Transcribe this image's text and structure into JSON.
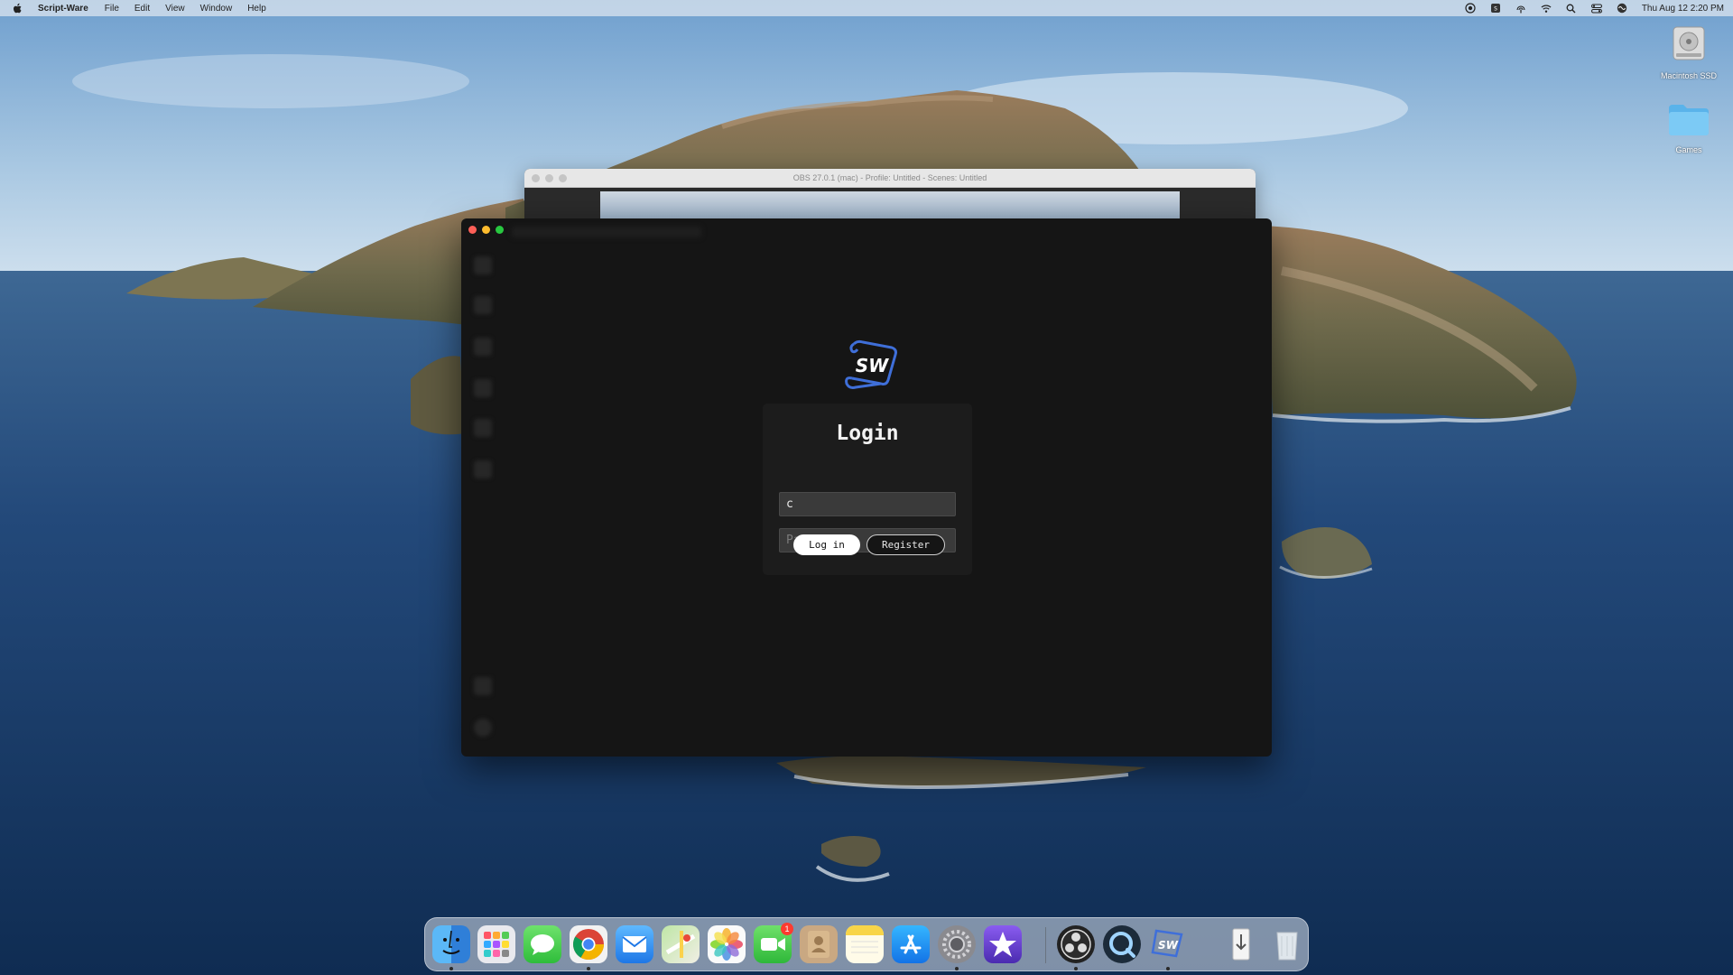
{
  "menubar": {
    "app_name": "Script-Ware",
    "menus": [
      "File",
      "Edit",
      "View",
      "Window",
      "Help"
    ],
    "clock": "Thu Aug 12  2:20 PM",
    "status_icons": [
      "screen-record-icon",
      "script-ware-menu-icon",
      "airdrop-icon",
      "wifi-icon",
      "spotlight-icon",
      "control-center-icon",
      "siri-icon"
    ]
  },
  "desktop": {
    "icons": [
      {
        "name": "Macintosh SSD",
        "icon": "hard-drive-icon"
      },
      {
        "name": "Games",
        "icon": "folder-icon"
      }
    ]
  },
  "obs_window": {
    "title": "OBS 27.0.1 (mac) - Profile: Untitled - Scenes: Untitled"
  },
  "login": {
    "title": "Login",
    "username_value": "c",
    "password_placeholder": "Password",
    "login_button": "Log in",
    "register_button": "Register",
    "logo_text": "SW"
  },
  "dock": {
    "items": [
      "finder-icon",
      "launchpad-icon",
      "messages-icon",
      "chrome-icon",
      "mail-icon",
      "maps-icon",
      "photos-icon",
      "facetime-icon",
      "contacts-icon",
      "notes-icon",
      "app-store-icon",
      "system-preferences-icon",
      "imovie-icon",
      "obs-icon",
      "quicktime-icon",
      "script-ware-icon",
      "downloads-icon",
      "trash-icon"
    ],
    "facetime_badge": "1"
  },
  "colors": {
    "login_card_bg": "#1c1c1c",
    "window_bg": "#151515",
    "logo_blue": "#3f6fd9"
  }
}
